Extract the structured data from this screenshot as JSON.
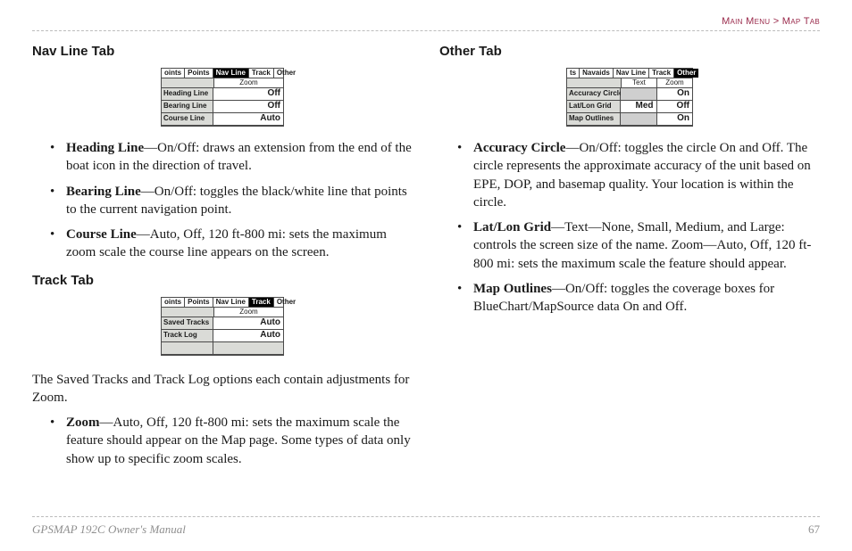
{
  "breadcrumb": "Main Menu > Map Tab",
  "footer": {
    "manual": "GPSMAP 192C Owner's Manual",
    "page": "67"
  },
  "nav_line": {
    "heading": "Nav Line Tab",
    "device": {
      "tabs": [
        "oints",
        "Points",
        "Nav Line",
        "Track",
        "Other"
      ],
      "active_tab": 2,
      "subheads": [
        "Zoom"
      ],
      "sub_span": 1,
      "rows": [
        {
          "label": "Heading Line",
          "vals": [
            "Off"
          ]
        },
        {
          "label": "Bearing Line",
          "vals": [
            "Off"
          ]
        },
        {
          "label": "Course Line",
          "vals": [
            "Auto"
          ]
        }
      ]
    },
    "items": [
      {
        "term": "Heading Line",
        "desc": "—On/Off: draws an extension from the end of the boat icon in the direction of travel."
      },
      {
        "term": "Bearing Line",
        "desc": "—On/Off: toggles the black/white line that points to the current navigation point."
      },
      {
        "term": "Course Line",
        "desc": "—Auto, Off, 120 ft-800 mi: sets the maximum zoom scale the course line appears on the screen."
      }
    ]
  },
  "track": {
    "heading": "Track Tab",
    "device": {
      "tabs": [
        "oints",
        "Points",
        "Nav Line",
        "Track",
        "Other"
      ],
      "active_tab": 3,
      "subheads": [
        "Zoom"
      ],
      "sub_span": 1,
      "rows": [
        {
          "label": "Saved Tracks",
          "vals": [
            "Auto"
          ]
        },
        {
          "label": "Track Log",
          "vals": [
            "Auto"
          ]
        },
        {
          "label": "",
          "vals": [
            ""
          ],
          "pad": true
        }
      ]
    },
    "body": "The Saved Tracks and Track Log options each contain adjustments for Zoom.",
    "items": [
      {
        "term": "Zoom",
        "desc": "—Auto, Off, 120 ft-800 mi: sets the maximum scale the feature should appear on the Map page. Some types of data only show up to specific zoom scales."
      }
    ]
  },
  "other": {
    "heading": "Other Tab",
    "device": {
      "tabs": [
        "ts",
        "Navaids",
        "Nav Line",
        "Track",
        "Other"
      ],
      "active_tab": 4,
      "subheads": [
        "Text",
        "Zoom"
      ],
      "sub_span": 2,
      "rows": [
        {
          "label": "Accuracy Circle",
          "vals": [
            "",
            "On"
          ],
          "shade": [
            true,
            false
          ]
        },
        {
          "label": "Lat/Lon Grid",
          "vals": [
            "Med",
            "Off"
          ]
        },
        {
          "label": "Map Outlines",
          "vals": [
            "",
            "On"
          ],
          "shade": [
            true,
            false
          ]
        }
      ]
    },
    "items": [
      {
        "term": "Accuracy Circle",
        "desc": "—On/Off: toggles the circle On and Off. The circle represents the approximate accuracy of the unit based on EPE, DOP, and basemap quality. Your location is within the circle."
      },
      {
        "term": "Lat/Lon Grid",
        "desc": "—Text—None, Small, Medium, and Large: controls the screen size of the name. Zoom—Auto, Off, 120 ft-800 mi: sets the maximum scale the feature should appear."
      },
      {
        "term": "Map Outlines",
        "desc": "—On/Off: toggles the coverage boxes for BlueChart/MapSource data On and Off."
      }
    ]
  }
}
